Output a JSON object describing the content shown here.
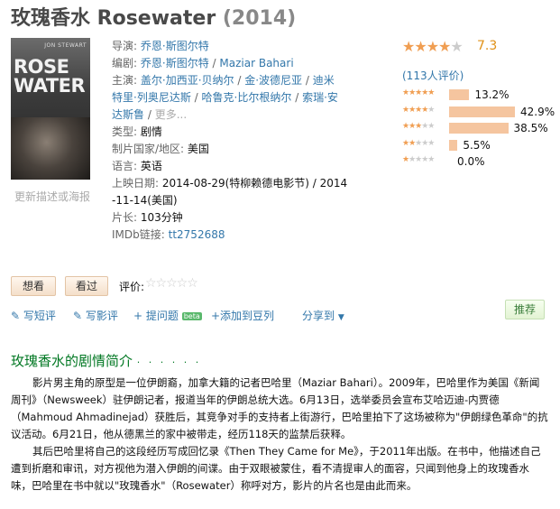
{
  "header": {
    "title": "玫瑰香水 Rosewater",
    "year": "(2014)"
  },
  "poster": {
    "director_text": "JON STEWART",
    "title_text": "ROSEWATER",
    "update_link": "更新描述或海报"
  },
  "info": {
    "director": {
      "label": "导演:",
      "value": "乔恩·斯图尔特"
    },
    "writer": {
      "label": "编剧:",
      "values": [
        "乔恩·斯图尔特",
        "Maziar Bahari"
      ]
    },
    "cast": {
      "label": "主演:",
      "values": [
        "盖尔·加西亚·贝纳尔",
        "金·波德尼亚",
        "迪米特里·列奥尼达斯",
        "哈鲁克·比尔根纳尔",
        "索瑞·安达斯鲁"
      ],
      "more": "更多..."
    },
    "genre": {
      "label": "类型:",
      "value": "剧情"
    },
    "country": {
      "label": "制片国家/地区:",
      "value": "美国"
    },
    "language": {
      "label": "语言:",
      "value": "英语"
    },
    "release": {
      "label": "上映日期:",
      "line1": "2014-08-29(特柳赖德电影节) / 2014",
      "line2": "-11-14(美国)"
    },
    "runtime": {
      "label": "片长:",
      "value": "103分钟"
    },
    "imdb": {
      "label": "IMDb链接:",
      "value": "tt2752688"
    }
  },
  "rating": {
    "score": "7.3",
    "stars": 3.5,
    "votes_text": "(113人评价)",
    "breakdown": [
      {
        "stars": 5,
        "percent_text": "13.2%",
        "fraction": 0.132
      },
      {
        "stars": 4,
        "percent_text": "42.9%",
        "fraction": 0.429
      },
      {
        "stars": 3,
        "percent_text": "38.5%",
        "fraction": 0.385
      },
      {
        "stars": 2,
        "percent_text": "5.5%",
        "fraction": 0.055
      },
      {
        "stars": 1,
        "percent_text": "0.0%",
        "fraction": 0.0
      }
    ]
  },
  "actions": {
    "want": "想看",
    "seen": "看过",
    "rate_label": "评价:",
    "write_short": "写短评",
    "write_review": "写影评",
    "ask": "+ 提问题",
    "beta": "beta",
    "add_list": "+添加到豆列",
    "share": "分享到",
    "recommend": "推荐"
  },
  "summary": {
    "title": "玫瑰香水的剧情简介",
    "dots": "· · · · · ·",
    "para1": "影片男主角的原型是一位伊朗裔，加拿大籍的记者巴哈里（Maziar Bahari）。2009年，巴哈里作为美国《新闻周刊》（Newsweek）驻伊朗记者，报道当年的伊朗总统大选。6月13日，选举委员会宣布艾哈迈迪-内贾德（Mahmoud Ahmadinejad）获胜后，其竞争对手的支持者上街游行，巴哈里拍下了这场被称为\"伊朗绿色革命\"的抗议活动。6月21日，他从德黑兰的家中被带走，经历118天的监禁后获释。",
    "para2": "其后巴哈里将自己的这段经历写成回忆录《Then They Came for Me》，于2011年出版。在书中，他描述自己遭到折磨和审讯，对方视他为潜入伊朗的间谍。由于双眼被蒙住，看不清提审人的面容，只闻到他身上的玫瑰香水味，巴哈里在书中就以\"玫瑰香水\"（Rosewater）称呼对方，影片的片名也是由此而来。"
  }
}
